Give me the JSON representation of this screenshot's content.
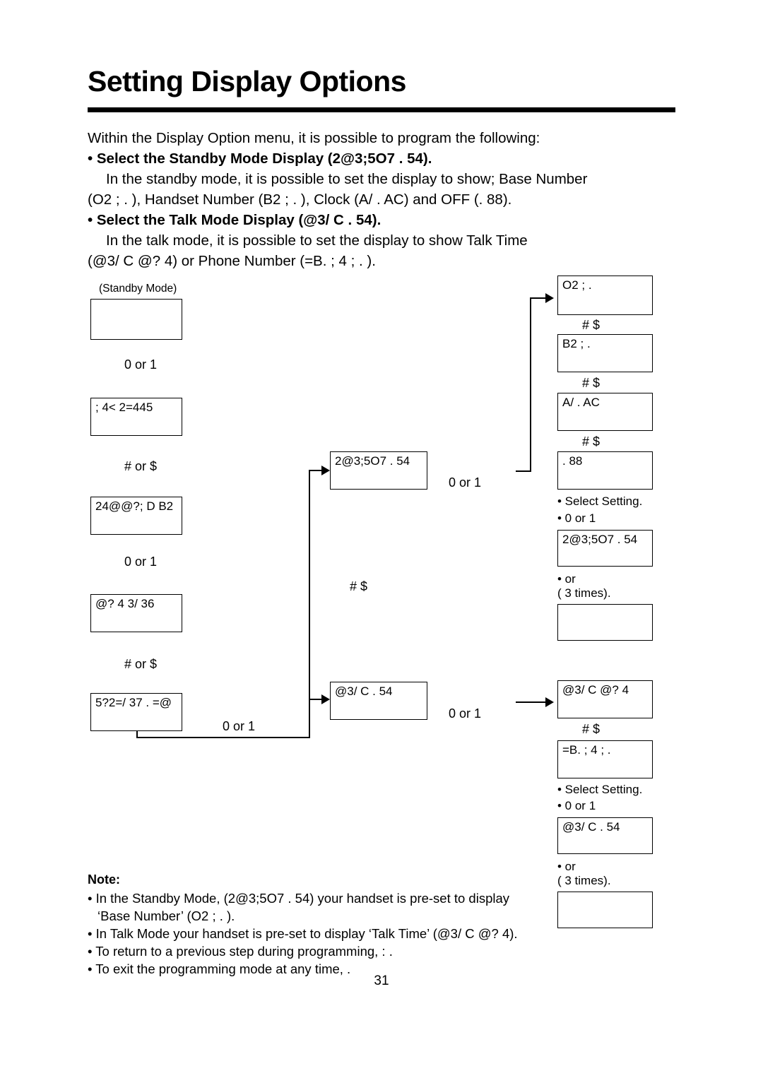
{
  "page": {
    "title": "Setting Display Options",
    "number": "31"
  },
  "intro": {
    "line1": "Within the Display Option menu, it is possible to program the following:",
    "bullet1": "• Select the Standby Mode Display (2@3;5O7 . 54).",
    "line2": "In the standby mode, it is possible to set the display to show; Base Number",
    "line3": "(O2 ; . ), Handset Number (B2 ; . ), Clock (A/ . AC) and OFF (. 88).",
    "bullet2": "• Select the Talk Mode Display (@3/ C . 54).",
    "line4": "In the talk mode, it is possible to set  the display to show Talk Time",
    "line5": "(@3/ C @? 4) or Phone Number (=B. ; 4 ; . )."
  },
  "diagram": {
    "standby_label": "(Standby Mode)",
    "left_column": [
      {
        "name": "standby-box",
        "text": ""
      },
      {
        "name": "box-phonebook",
        "text": "; 4< 2=445"
      },
      {
        "name": "box-caller-id",
        "text": "24@@?; D B2"
      },
      {
        "name": "box-ringer",
        "text": "@? 4 3/ 36"
      },
      {
        "name": "box-options",
        "text": "5?2=/ 37 . =@"
      }
    ],
    "left_connectors": [
      {
        "name": "connector-0-or-1-a",
        "text": "0   or   1"
      },
      {
        "name": "connector-hash-or-dollar-a",
        "text": "#   or  $"
      },
      {
        "name": "connector-0-or-1-b",
        "text": "0   or   1"
      },
      {
        "name": "connector-hash-or-dollar-b",
        "text": "#   or  $"
      },
      {
        "name": "connector-0-or-1-c",
        "text": "0   or   1"
      }
    ],
    "middle_column": [
      {
        "name": "box-standby-display",
        "text": "2@3;5O7 . 54"
      },
      {
        "name": "box-talk-display",
        "text": "@3/ C . 54"
      }
    ],
    "middle_connectors": [
      {
        "name": "connector-0-or-1-d",
        "text": "0   or   1"
      },
      {
        "name": "connector-hash-or-dollar-c",
        "text": "#     $"
      },
      {
        "name": "connector-0-or-1-e",
        "text": "0   or   1"
      }
    ],
    "right_top_boxes": [
      {
        "name": "box-base-number",
        "text": "O2 ; ."
      },
      {
        "name": "box-handset-number",
        "text": "B2 ; ."
      },
      {
        "name": "box-clock",
        "text": "A/ . AC"
      },
      {
        "name": "box-off",
        "text": ". 88"
      }
    ],
    "right_top_connectors": [
      {
        "name": "connector-hash-dollar-1",
        "text": "#      $"
      },
      {
        "name": "connector-hash-dollar-2",
        "text": "#      $"
      },
      {
        "name": "connector-hash-dollar-3",
        "text": "#      $"
      }
    ],
    "right_top_steps": {
      "select_setting": "• Select Setting.",
      "press_label": "•            0   or   1",
      "result_box": "2@3;5O7 . 54",
      "or_label": "•                     or",
      "times_label": "(            3 times).",
      "blank_box": ""
    },
    "right_bottom_boxes": [
      {
        "name": "box-talk-time",
        "text": "@3/ C @? 4"
      },
      {
        "name": "box-phone-number",
        "text": "=B. ; 4 ; ."
      }
    ],
    "right_bottom_connectors": [
      {
        "name": "connector-hash-dollar-4",
        "text": "#      $"
      }
    ],
    "right_bottom_steps": {
      "select_setting": "• Select Setting.",
      "press_label": "•            0   or   1",
      "result_box": "@3/ C . 54",
      "or_label": "•                     or",
      "times_label": "(            3 times).",
      "blank_box": ""
    }
  },
  "note": {
    "heading": "Note:",
    "items": [
      "• In the Standby Mode, (2@3;5O7 . 54) your handset is pre-set to display",
      "‘Base Number’ (O2 ; . ).",
      "• In Talk Mode your handset is pre-set to display ‘Talk Time’ (@3/ C @? 4).",
      "• To return to a previous step during programming,          : .",
      "• To exit the programming mode at any time,                ."
    ]
  }
}
